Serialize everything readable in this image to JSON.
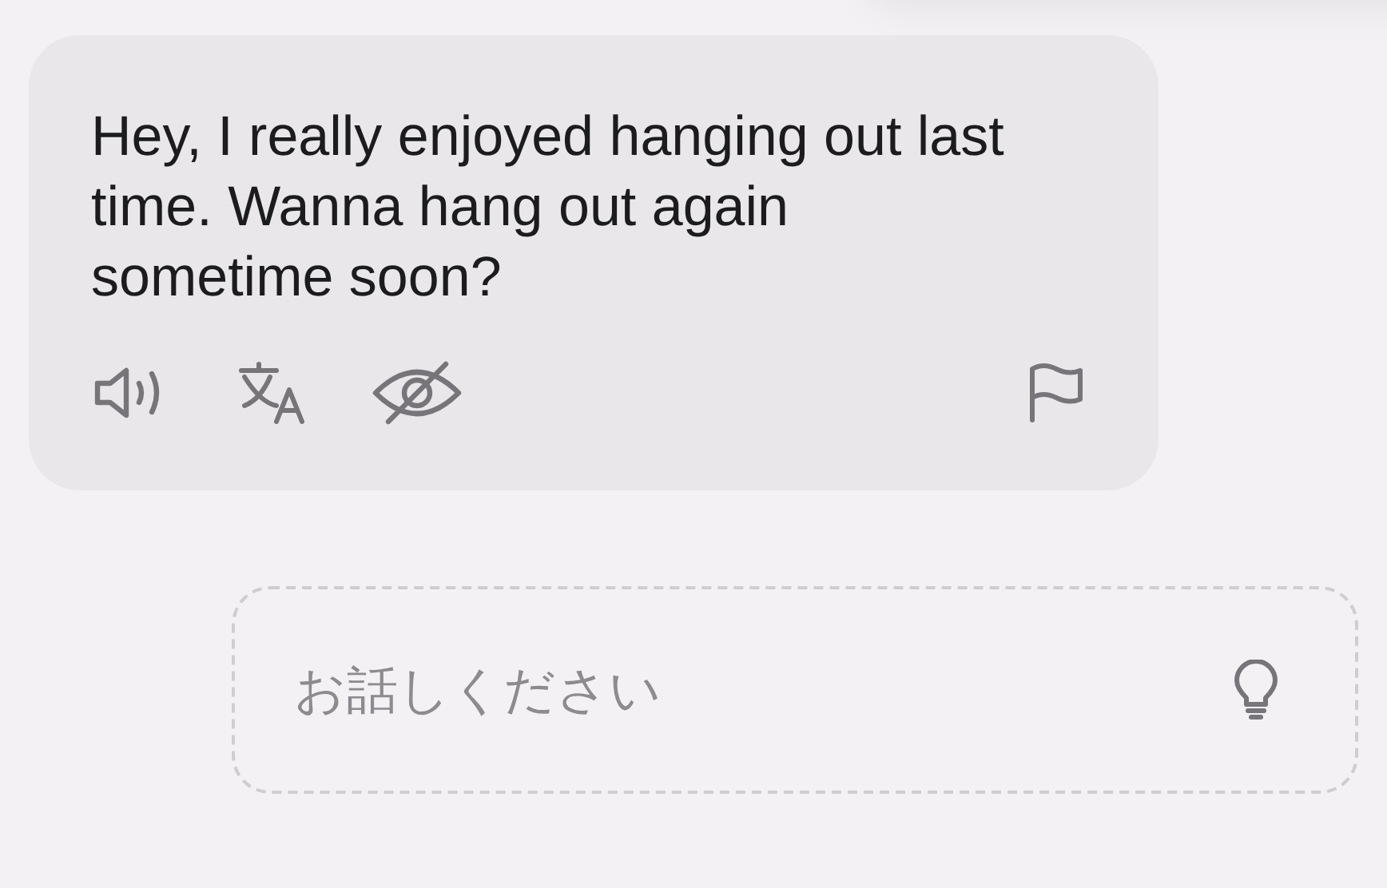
{
  "message": {
    "text": "Hey, I really enjoyed hanging out last time. Wanna hang out again sometime soon?"
  },
  "input": {
    "placeholder": "お話しください"
  }
}
